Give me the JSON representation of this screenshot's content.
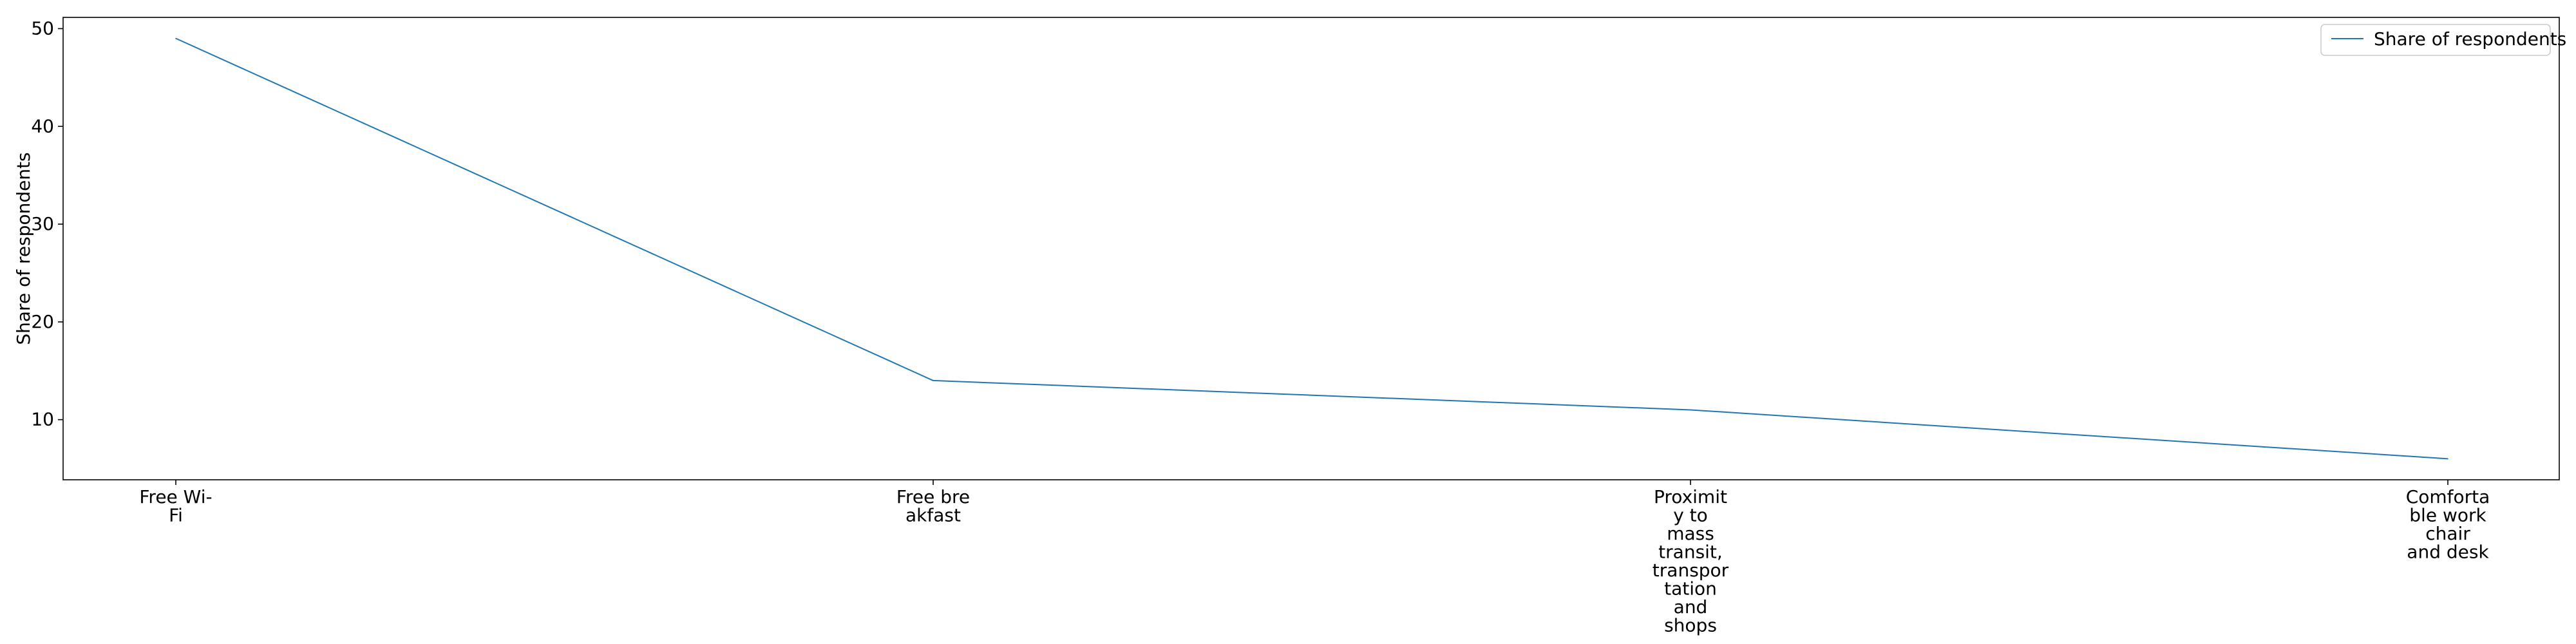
{
  "chart_data": {
    "type": "line",
    "title": "",
    "xlabel": "",
    "ylabel": "Share of respondents",
    "categories": [
      [
        "Free Wi-",
        "Fi"
      ],
      [
        "Free bre",
        "akfast"
      ],
      [
        "Proximit",
        "y to",
        "mass",
        "transit,",
        "transpor",
        "tation",
        "and",
        "shops"
      ],
      [
        "Comforta",
        "ble work",
        "chair",
        "and desk"
      ]
    ],
    "series": [
      {
        "name": "Share of respondents",
        "values": [
          49,
          14,
          11,
          6
        ],
        "color": "#1f77b4"
      }
    ],
    "ylim": [
      3.85,
      51.15
    ],
    "yticks": [
      10,
      20,
      30,
      40,
      50
    ],
    "grid": false,
    "legend": "top-right"
  }
}
